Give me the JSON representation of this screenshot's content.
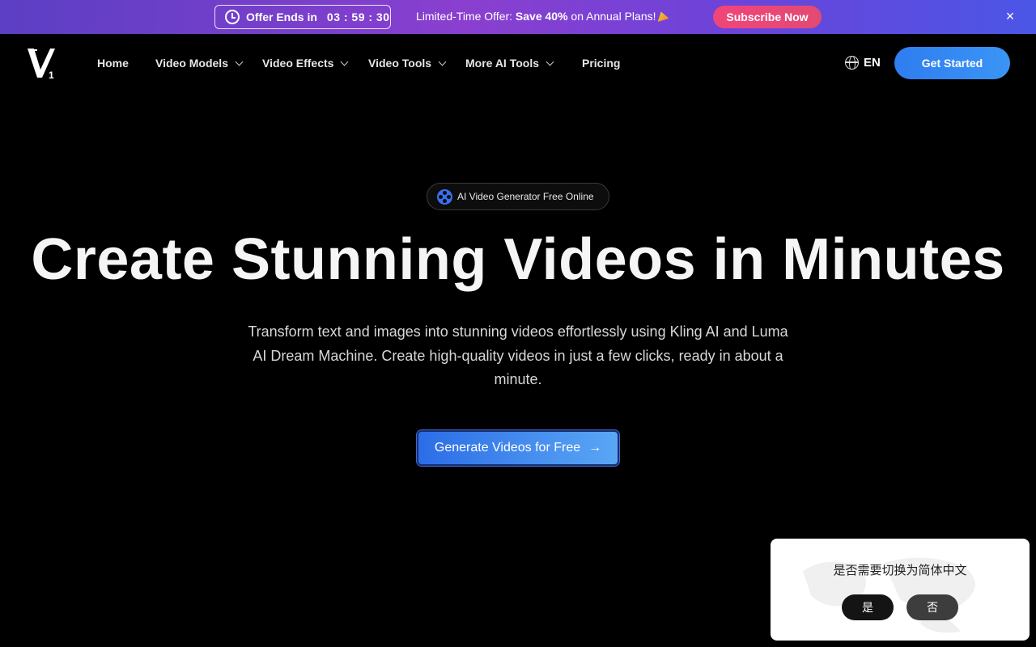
{
  "promo": {
    "offer_label": "Offer Ends in",
    "countdown": "03 : 59 : 30",
    "message_prefix": "Limited-Time Offer: ",
    "message_bold": "Save 40%",
    "message_suffix": " on Annual Plans!",
    "subscribe_label": "Subscribe Now",
    "close_symbol": "×",
    "colors": {
      "gradient_start": "#5b3fc4",
      "gradient_end": "#4b56e6",
      "subscribe": "#f0457a"
    }
  },
  "nav": {
    "logo_text": "V1",
    "items": [
      {
        "label": "Home",
        "has_dropdown": false
      },
      {
        "label": "Video Models",
        "has_dropdown": true
      },
      {
        "label": "Video Effects",
        "has_dropdown": true
      },
      {
        "label": "Video Tools",
        "has_dropdown": true
      },
      {
        "label": "More AI Tools",
        "has_dropdown": true
      },
      {
        "label": "Pricing",
        "has_dropdown": false
      }
    ],
    "language": "EN",
    "get_started_label": "Get Started",
    "accent": "#2f7df0"
  },
  "hero": {
    "badge": "AI Video Generator Free Online",
    "title": "Create Stunning Videos in Minutes",
    "subtitle": "Transform text and images into stunning videos effortlessly using Kling AI and Luma AI Dream Machine. Create high-quality videos in just a few clicks, ready in about a minute.",
    "cta_label": "Generate Videos for Free",
    "cta_arrow": "→"
  },
  "language_dialog": {
    "text": "是否需要切换为简体中文",
    "yes_label": "是",
    "no_label": "否"
  }
}
